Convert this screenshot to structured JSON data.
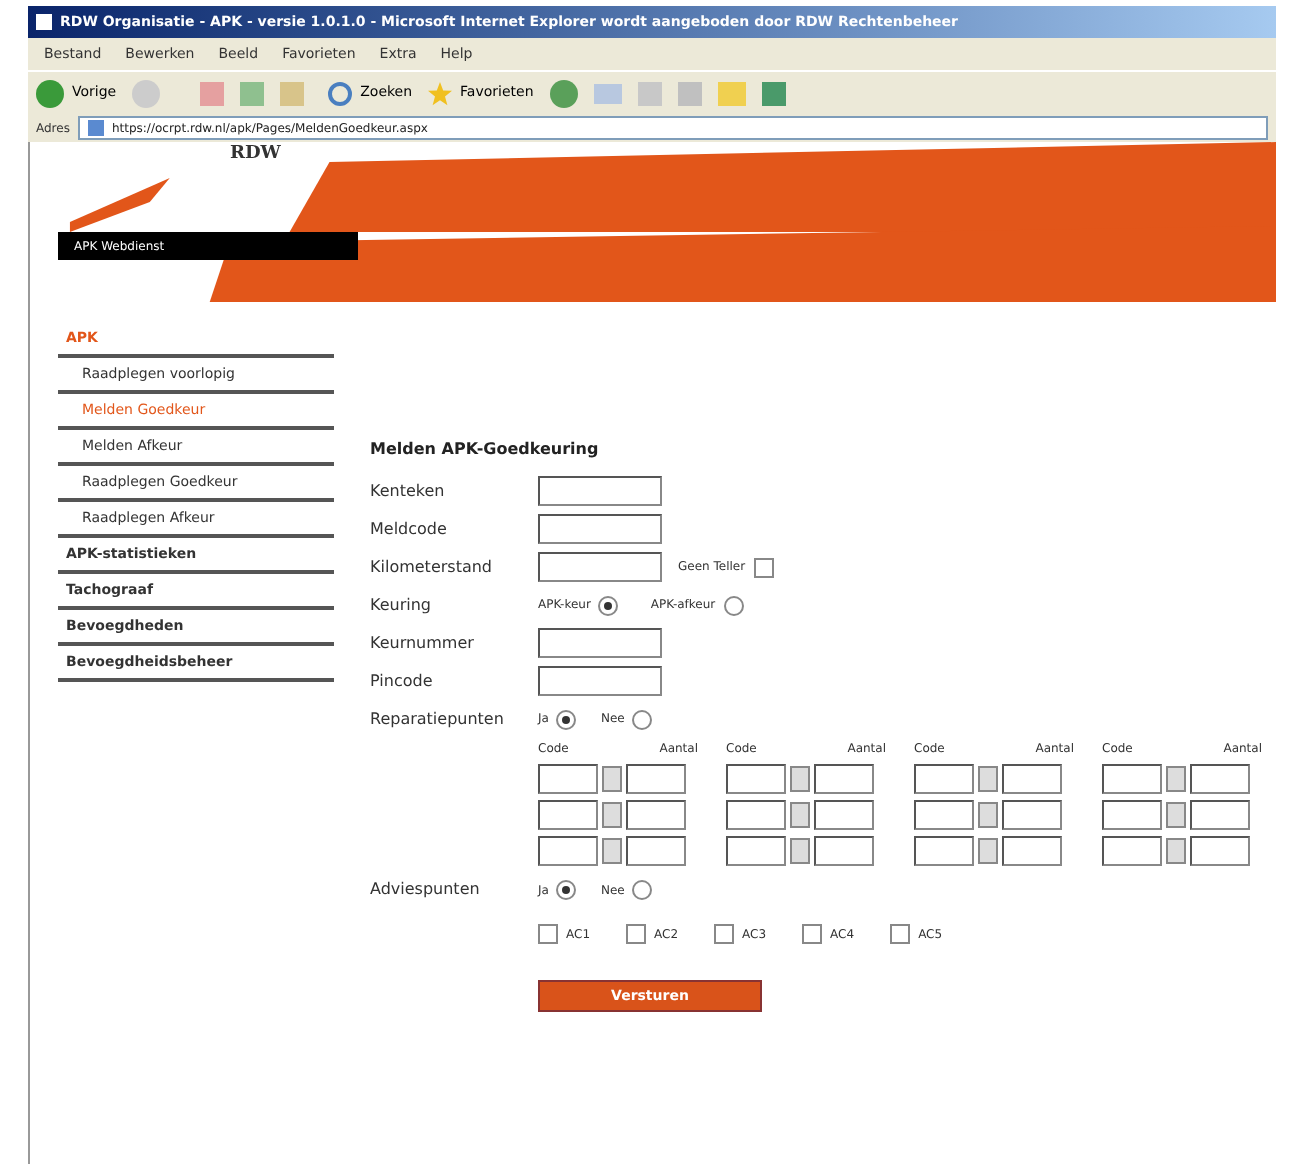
{
  "window": {
    "title": "RDW Organisatie - APK - versie 1.0.1.0 - Microsoft Internet Explorer wordt aangeboden door RDW Rechtenbeheer"
  },
  "menu": [
    "Bestand",
    "Bewerken",
    "Beeld",
    "Favorieten",
    "Extra",
    "Help"
  ],
  "toolbar": {
    "back": "Vorige",
    "search": "Zoeken",
    "favorites": "Favorieten"
  },
  "address": {
    "label": "Adres",
    "value": "https://ocrpt.rdw.nl/apk/Pages/MeldenGoedkeur.aspx"
  },
  "header": {
    "logo": "RDW",
    "banner": "APK Webdienst"
  },
  "sidebar": [
    {
      "label": "APK",
      "kind": "section",
      "selected": true
    },
    {
      "label": "Raadplegen voorlopig",
      "kind": "sub",
      "selected": false
    },
    {
      "label": "Melden Goedkeur",
      "kind": "sub",
      "selected": true
    },
    {
      "label": "Melden Afkeur",
      "kind": "sub",
      "selected": false
    },
    {
      "label": "Raadplegen Goedkeur",
      "kind": "sub",
      "selected": false
    },
    {
      "label": "Raadplegen Afkeur",
      "kind": "sub",
      "selected": false
    },
    {
      "label": "APK-statistieken",
      "kind": "section",
      "selected": false
    },
    {
      "label": "Tachograaf",
      "kind": "section",
      "selected": false
    },
    {
      "label": "Bevoegdheden",
      "kind": "section",
      "selected": false
    },
    {
      "label": "Bevoegdheidsbeheer",
      "kind": "section",
      "selected": false
    }
  ],
  "form": {
    "title": "Melden APK-Goedkeuring",
    "fields": [
      {
        "label": "Kenteken"
      },
      {
        "label": "Meldcode"
      },
      {
        "label": "Kilometerstand",
        "extra_checkbox": {
          "label": "Geen Teller",
          "checked": false
        }
      }
    ],
    "keuring": {
      "label": "Keuring",
      "options": [
        {
          "label": "APK-keur",
          "selected": true
        },
        {
          "label": "APK-afkeur",
          "selected": false
        }
      ]
    },
    "fields2": [
      {
        "label": "Keurnummer"
      },
      {
        "label": "Pincode"
      }
    ],
    "repairs": {
      "label": "Reparatiepunten",
      "options": [
        {
          "label": "Ja",
          "selected": true
        },
        {
          "label": "Nee",
          "selected": false
        }
      ],
      "groups": [
        {
          "headers": [
            "Code",
            "Aantal"
          ]
        },
        {
          "headers": [
            "Code",
            "Aantal"
          ]
        },
        {
          "headers": [
            "Code",
            "Aantal"
          ]
        },
        {
          "headers": [
            "Code",
            "Aantal"
          ]
        }
      ]
    },
    "advice": {
      "label": "Adviespunten",
      "options": [
        {
          "label": "Ja",
          "selected": true
        },
        {
          "label": "Nee",
          "selected": false
        }
      ]
    },
    "advice_codes": [
      {
        "label": "AC1",
        "checked": false
      },
      {
        "label": "AC2",
        "checked": false
      },
      {
        "label": "AC3",
        "checked": false
      },
      {
        "label": "AC4",
        "checked": false
      },
      {
        "label": "AC5",
        "checked": false
      }
    ],
    "submit": "Versturen"
  }
}
